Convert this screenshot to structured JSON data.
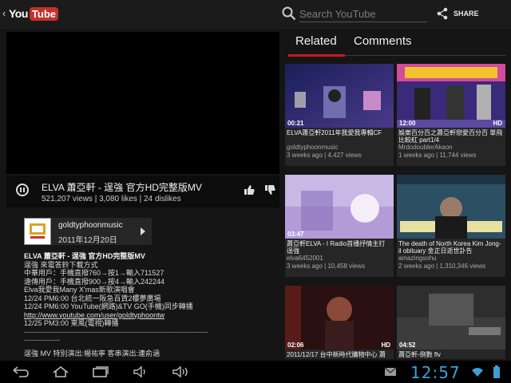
{
  "app": {
    "logo_you": "You",
    "logo_tube": "Tube"
  },
  "search": {
    "placeholder": "Search YouTube"
  },
  "toolbar": {
    "share_label": "SHARE"
  },
  "video": {
    "title": "ELVA 蕭亞軒 - 逞強 官方HD完整版MV",
    "stats": "521,207 views | 3,080 likes | 24 dislikes"
  },
  "channel": {
    "name": "goldtyphoonmusic",
    "date": "2011年12月20日"
  },
  "description": {
    "title": "ELVA 蕭亞軒 - 逞強 官方HD完整版MV",
    "lines": [
      "逞強 來電答鈴下載方式",
      "中華用戶：手機直撥760→按1→輸入711527",
      "遠傳用戶：手機直撥900→按4→輸入242244",
      "Elva我愛我Many X'mas新歌演唱會",
      "12/24 PM6:00 台北統一阪急百貨2樓夢廣場",
      "12/24 PM6:00 YouTube(網路)&TV GO(手機)同步轉播"
    ],
    "link": "http://www.youtube.com/user/goldtyphoontw",
    "line_after_link": "12/25 PM3:00 東風(電視)轉播",
    "separator": "-----------------------------------------------------------------------------",
    "separator_2": "---------------",
    "last_line": "逞強 MV 特別演出:楊祐寧 客串演出:連俞涵"
  },
  "tabs": {
    "related": "Related",
    "comments": "Comments"
  },
  "related": [
    {
      "duration": "00:21",
      "hd": "",
      "title": "ELVA蕭亞軒2011年我愛我專輯CF",
      "author": "goldtyphoonmusic",
      "meta": "3 weeks ago | 4,427 views"
    },
    {
      "duration": "12:00",
      "hd": "HD",
      "title": "娛樂百分百之蕭亞軒戀愛百分百 單飛比較紅 part1/4",
      "author": "MrdodoublerAkaon",
      "meta": "1 weeks ago | 11,744 views"
    },
    {
      "duration": "03:47",
      "hd": "",
      "title": "蕭亞軒ELVA - I Radio首播抒情主打 逞強",
      "author": "elva6452001",
      "meta": "3 weeks ago | 10,458 views"
    },
    {
      "duration": "",
      "hd": "",
      "title": "The death of North Korea Kim Jong-il obituary 金正日逝世訃告",
      "author": "amazingsohu",
      "meta": "2 weeks ago | 1,310,346 views"
    },
    {
      "duration": "02:06",
      "hd": "HD",
      "title": "2011/12/17 台中新時代購物中心 蕭",
      "author": "",
      "meta": ""
    },
    {
      "duration": "04:52",
      "hd": "",
      "title": "蕭亞軒-倒數 flv",
      "author": "",
      "meta": ""
    }
  ],
  "system": {
    "clock": "12:57"
  },
  "colors": {
    "accent": "#cc181e",
    "clock": "#3d9fd6",
    "logo_red": "#c4302b"
  }
}
